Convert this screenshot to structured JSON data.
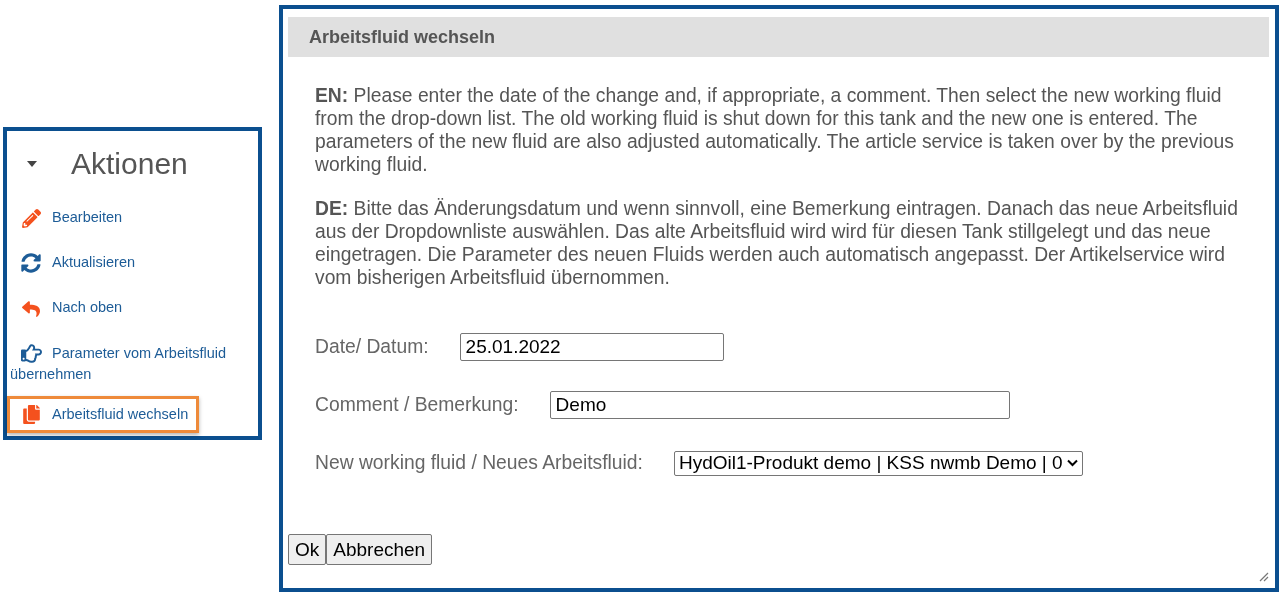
{
  "sidebar": {
    "title": "Aktionen",
    "expanded": true,
    "items": [
      {
        "label": "Bearbeiten",
        "highlighted": false
      },
      {
        "label": "Aktualisieren",
        "highlighted": false
      },
      {
        "label": "Nach oben",
        "highlighted": false
      },
      {
        "label": "Parameter vom Arbeitsfluid übernehmen",
        "highlighted": false
      },
      {
        "label": "Arbeitsfluid wechseln",
        "highlighted": true
      }
    ]
  },
  "dialog": {
    "title": "Arbeitsfluid wechseln",
    "paragraphs": [
      "**EN:** Please enter the date of the change and, if appropriate, a comment. Then select the new working fluid from the drop-down list. The old working fluid is shut down for this tank and the new one is entered. The parameters of the new fluid are also adjusted automatically. The article service is taken over by the previous working fluid.",
      "**DE:** Bitte das Änderungsdatum und wenn sinnvoll, eine Bemerkung eintragen. Danach das neue Arbeitsfluid aus der Dropdownliste auswählen. Das alte Arbeitsfluid wird wird für diesen Tank stillgelegt und das neue eingetragen. Die Parameter des neuen Fluids werden auch automatisch angepasst. Der Artikelservice wird vom bisherigen Arbeitsfluid übernommen."
    ],
    "fields": [
      {
        "kind": "text",
        "label": "Date/ Datum:",
        "value": "25.01.2022"
      },
      {
        "kind": "text",
        "label": "Comment / Bemerkung:",
        "value": "Demo"
      },
      {
        "kind": "select",
        "label": "New working fluid / Neues Arbeitsfluid:",
        "value": "HydOil1-Produkt demo | KSS nwmb Demo | 0"
      }
    ],
    "buttons": [
      "Ok",
      "Abbrechen"
    ]
  }
}
